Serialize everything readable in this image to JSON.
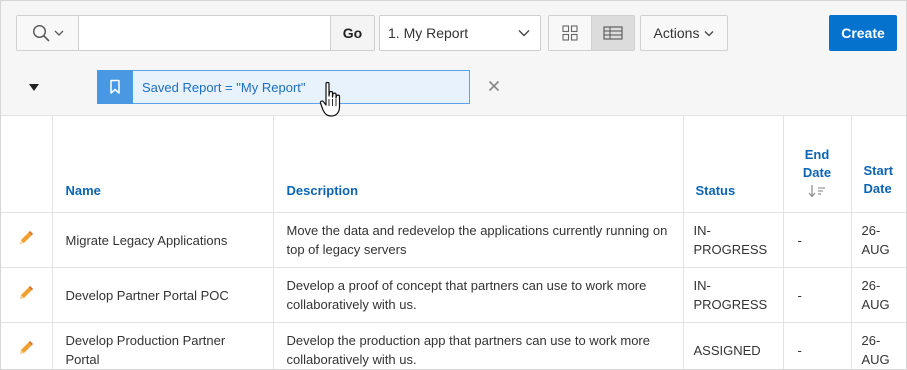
{
  "toolbar": {
    "search": {
      "value": "",
      "placeholder": ""
    },
    "go_label": "Go",
    "report_select": {
      "selected": "1. My Report"
    },
    "actions_label": "Actions",
    "create_label": "Create"
  },
  "filter": {
    "chip_label": "Saved Report = \"My Report\""
  },
  "table": {
    "columns": {
      "name": "Name",
      "description": "Description",
      "status": "Status",
      "end_date": [
        "End",
        "Date"
      ],
      "start_date": [
        "Start",
        "Date"
      ]
    },
    "rows": [
      {
        "name": "Migrate Legacy Applications",
        "description": "Move the data and redevelop the applications currently running on top of legacy servers",
        "status": [
          "IN-",
          "PROGRESS"
        ],
        "end_date": "-",
        "start_date": [
          "26-",
          "AUG"
        ]
      },
      {
        "name": "Develop Partner Portal POC",
        "description": "Develop a proof of concept that partners can use to work more collaboratively with us.",
        "status": [
          "IN-",
          "PROGRESS"
        ],
        "end_date": "-",
        "start_date": [
          "26-",
          "AUG"
        ]
      },
      {
        "name": "Develop Production Partner Portal",
        "description": "Develop the production app that partners can use to work more collaboratively with us.",
        "status": [
          "ASSIGNED"
        ],
        "end_date": "-",
        "start_date": [
          "26-",
          "AUG"
        ]
      }
    ]
  },
  "colors": {
    "accent": "#0572ce",
    "link": "#0c64b5",
    "chip_bg": "#e8f2fc",
    "chip_icon_bg": "#4a98e2",
    "edit_icon": "#f0a030"
  },
  "icons": {
    "search": "search-icon",
    "chevron": "chevron-down-icon",
    "grid_view": "grid-view-icon",
    "report_view": "report-view-icon",
    "bookmark": "bookmark-icon",
    "remove": "close-icon",
    "collapse": "collapse-triangle-icon",
    "edit": "pencil-icon",
    "sort": "sort-descending-icon"
  }
}
